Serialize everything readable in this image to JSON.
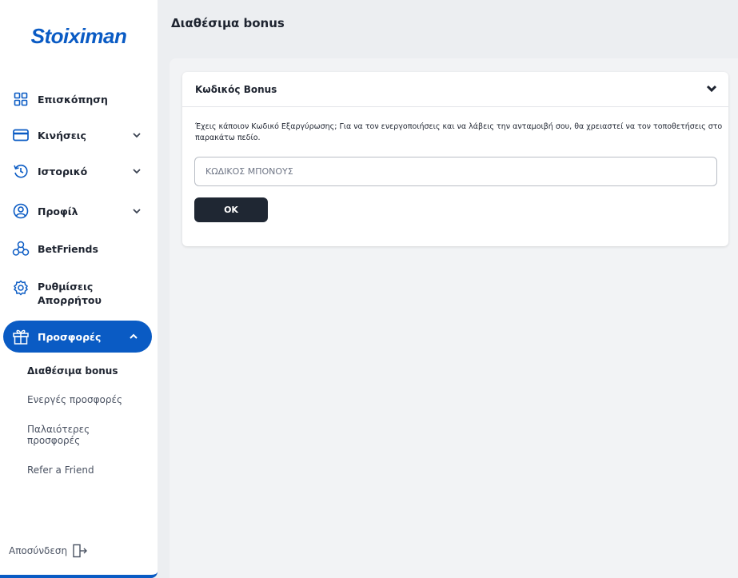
{
  "brand": {
    "logo_text": "Stoiximan",
    "accent_color": "#0a5bc4"
  },
  "sidebar": {
    "items": [
      {
        "label": "Επισκόπηση",
        "icon": "grid-icon",
        "has_chevron": false
      },
      {
        "label": "Κινήσεις",
        "icon": "card-icon",
        "has_chevron": true
      },
      {
        "label": "Ιστορικό",
        "icon": "history-icon",
        "has_chevron": true
      },
      {
        "label": "Προφίλ",
        "icon": "user-icon",
        "has_chevron": true
      },
      {
        "label": "BetFriends",
        "icon": "friends-icon",
        "has_chevron": false
      },
      {
        "label": "Ρυθμίσεις Απορρήτου",
        "icon": "gear-icon",
        "has_chevron": false
      },
      {
        "label": "Προσφορές",
        "icon": "gift-icon",
        "has_chevron": true,
        "active": true,
        "expanded": true
      }
    ],
    "subitems": [
      {
        "label": "Διαθέσιμα bonus",
        "active": true
      },
      {
        "label": "Ενεργές προσφορές"
      },
      {
        "label": "Παλαιότερες προσφορές"
      },
      {
        "label": "Refer a Friend"
      }
    ],
    "logout_label": "Αποσύνδεση"
  },
  "main": {
    "page_title": "Διαθέσιμα bonus",
    "card": {
      "title": "Κωδικός Bonus",
      "description": "Έχεις κάποιον Κωδικό Εξαργύρωσης; Για να τον ενεργοποιήσεις και να λάβεις την ανταμοιβή σου, θα χρειαστεί να τον τοποθετήσεις στο παρακάτω πεδίο.",
      "input_placeholder": "ΚΩΔΙΚΟΣ ΜΠΟΝΟΥΣ",
      "input_value": "",
      "ok_label": "OK"
    }
  }
}
